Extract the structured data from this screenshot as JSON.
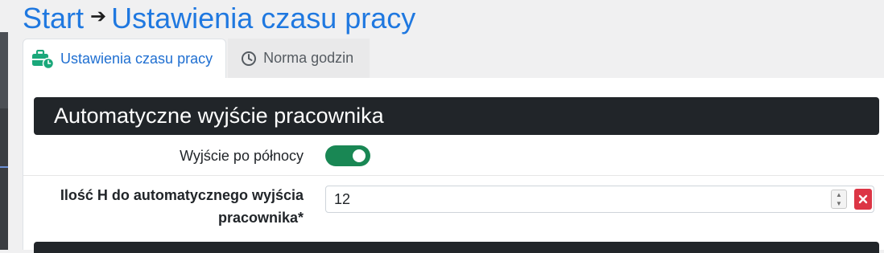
{
  "breadcrumb": {
    "home": "Start",
    "separator": "➔",
    "current": "Ustawienia czasu pracy"
  },
  "tabs": [
    {
      "label": "Ustawienia czasu pracy",
      "icon": "briefcase-clock-icon",
      "active": true
    },
    {
      "label": "Norma godzin",
      "icon": "clock-icon",
      "active": false
    }
  ],
  "section": {
    "title": "Automatyczne wyjście pracownika"
  },
  "fields": {
    "midnight_exit": {
      "label": "Wyjście po północy",
      "enabled": true
    },
    "auto_exit_hours": {
      "label": "Ilość H do automatycznego wyjścia pracownika*",
      "value": "12"
    }
  },
  "colors": {
    "link": "#1f78e0",
    "tab_active": "#1f6fd1",
    "header_bg": "#212529",
    "toggle_on": "#198754",
    "danger": "#dc3545",
    "icon_green": "#1aa87a"
  }
}
